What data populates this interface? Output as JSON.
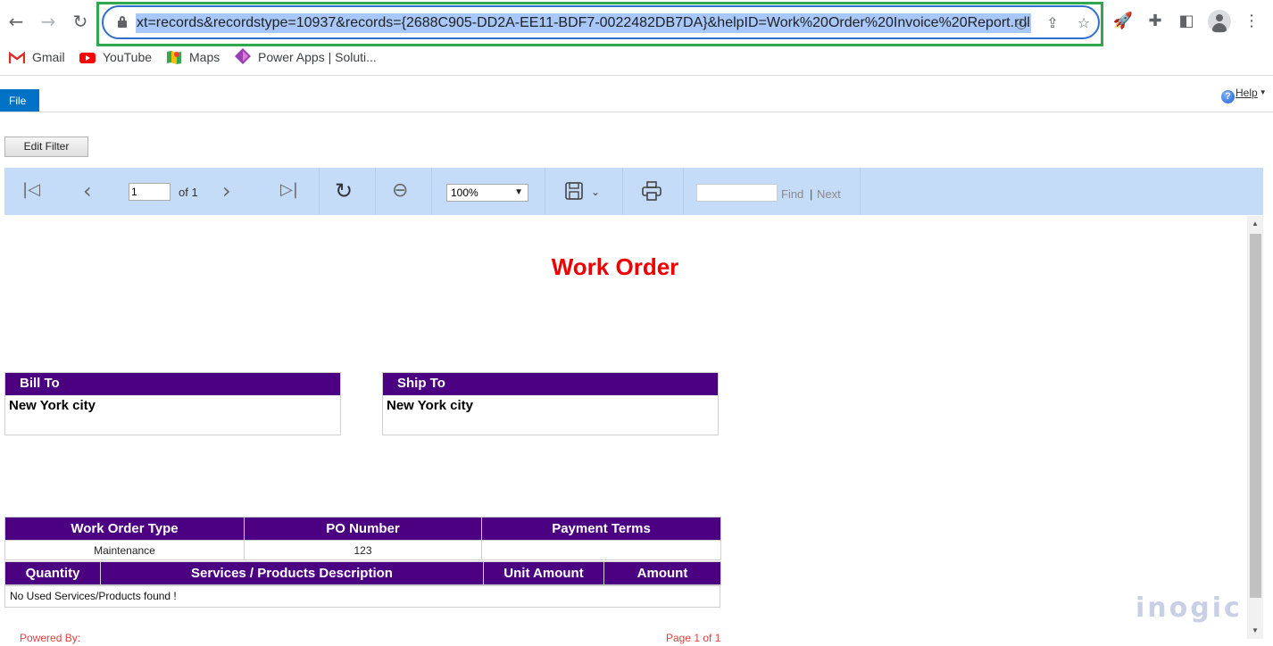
{
  "browser": {
    "url": "xt=records&recordstype=10937&records={2688C905-DD2A-EE11-BDF7-0022482DB7DA}&helpID=Work%20Order%20Invoice%20Report.rdl",
    "bookmarks": [
      {
        "label": "Gmail",
        "icon": "gmail-icon"
      },
      {
        "label": "YouTube",
        "icon": "youtube-icon"
      },
      {
        "label": "Maps",
        "icon": "maps-icon"
      },
      {
        "label": "Power Apps | Soluti...",
        "icon": "power-apps-icon"
      }
    ],
    "highlight_color": "#2fa84f"
  },
  "ribbon": {
    "file_tab": "File",
    "help_label": "Help",
    "help_icon": "?"
  },
  "edit_filter_label": "Edit Filter",
  "toolbar": {
    "page_value": "1",
    "page_of": "of 1",
    "zoom_value": "100%",
    "find_value": "",
    "find_label": "Find",
    "separator": "|",
    "next_label": "Next"
  },
  "report": {
    "title": "Work Order",
    "bill_to": {
      "label": "Bill To",
      "value": "New York city"
    },
    "ship_to": {
      "label": "Ship To",
      "value": "New York city"
    },
    "summary_headers": [
      "Work Order Type",
      "PO Number",
      "Payment Terms"
    ],
    "summary_values": [
      "Maintenance",
      "123",
      ""
    ],
    "items_headers": [
      "Quantity",
      "Services / Products Description",
      "Unit Amount",
      "Amount"
    ],
    "empty_message": "No Used Services/Products found !",
    "footer_left": "Powered By:",
    "footer_right": "Page 1 of 1",
    "header_color": "#4b0082",
    "title_color": "#ee0000"
  },
  "watermark": "inogic"
}
